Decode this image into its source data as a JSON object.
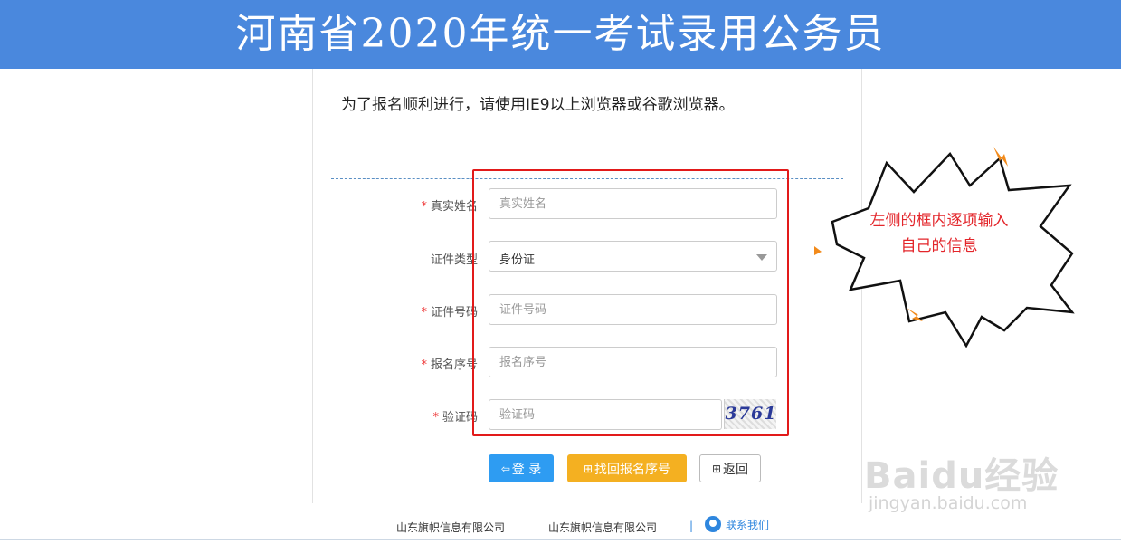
{
  "banner": {
    "title": "河南省2020年统一考试录用公务员"
  },
  "notice": "为了报名顺利进行，请使用IE9以上浏览器或谷歌浏览器。",
  "form": {
    "required_mark": "*",
    "name": {
      "label": "真实姓名",
      "placeholder": "真实姓名"
    },
    "id_type": {
      "label": "证件类型",
      "value": "身份证"
    },
    "id_number": {
      "label": "证件号码",
      "placeholder": "证件号码"
    },
    "reg_number": {
      "label": "报名序号",
      "placeholder": "报名序号"
    },
    "captcha": {
      "label": "验证码",
      "placeholder": "验证码",
      "image_text": "3761"
    }
  },
  "buttons": {
    "login": {
      "icon": "login-icon",
      "label": "登 录"
    },
    "find": {
      "icon": "binoculars-icon",
      "label": "找回报名序号"
    },
    "back": {
      "icon": "binoculars-icon",
      "label": "返回"
    }
  },
  "footer": {
    "company1": "山东旗帜信息有限公司",
    "company2": "山东旗帜信息有限公司",
    "separator": "|",
    "contact": "联系我们"
  },
  "annotation": {
    "line1": "左侧的框内逐项输入",
    "line2": "自己的信息"
  },
  "watermark": {
    "brand": "Baidu经验",
    "url": "jingyan.baidu.com"
  },
  "colors": {
    "banner": "#4a88dd",
    "highlight": "#e21a1a",
    "login": "#2e9cf2",
    "find": "#f4b021"
  }
}
